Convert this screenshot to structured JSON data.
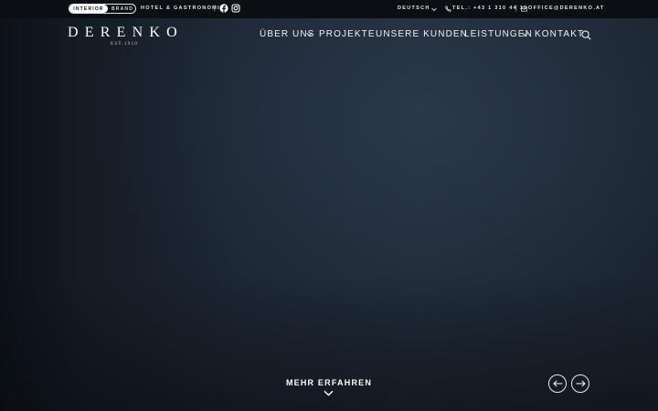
{
  "topbar": {
    "switch": {
      "active": "INTERIOR",
      "inactive": "BRAND"
    },
    "hotel": "HOTEL & GASTRONOMIE",
    "separator": "|",
    "social": [
      "facebook-icon",
      "instagram-icon"
    ],
    "language": "DEUTSCH",
    "phone": "TEL.: +43 1 310 44 15",
    "email": "OFFICE@DERENKO.AT"
  },
  "header": {
    "logo": "DERENKO",
    "logo_sub": "EST.1910",
    "nav": [
      "ÜBER UNS",
      "PROJEKTE",
      "UNSERE KUNDEN",
      "LEISTUNGEN",
      "KONTAKT"
    ]
  },
  "hero": {
    "cta": "MEHR ERFAHREN"
  },
  "colors": {
    "background": "#1f2a37",
    "topbar": "#0b0f13",
    "text": "#ffffff"
  }
}
